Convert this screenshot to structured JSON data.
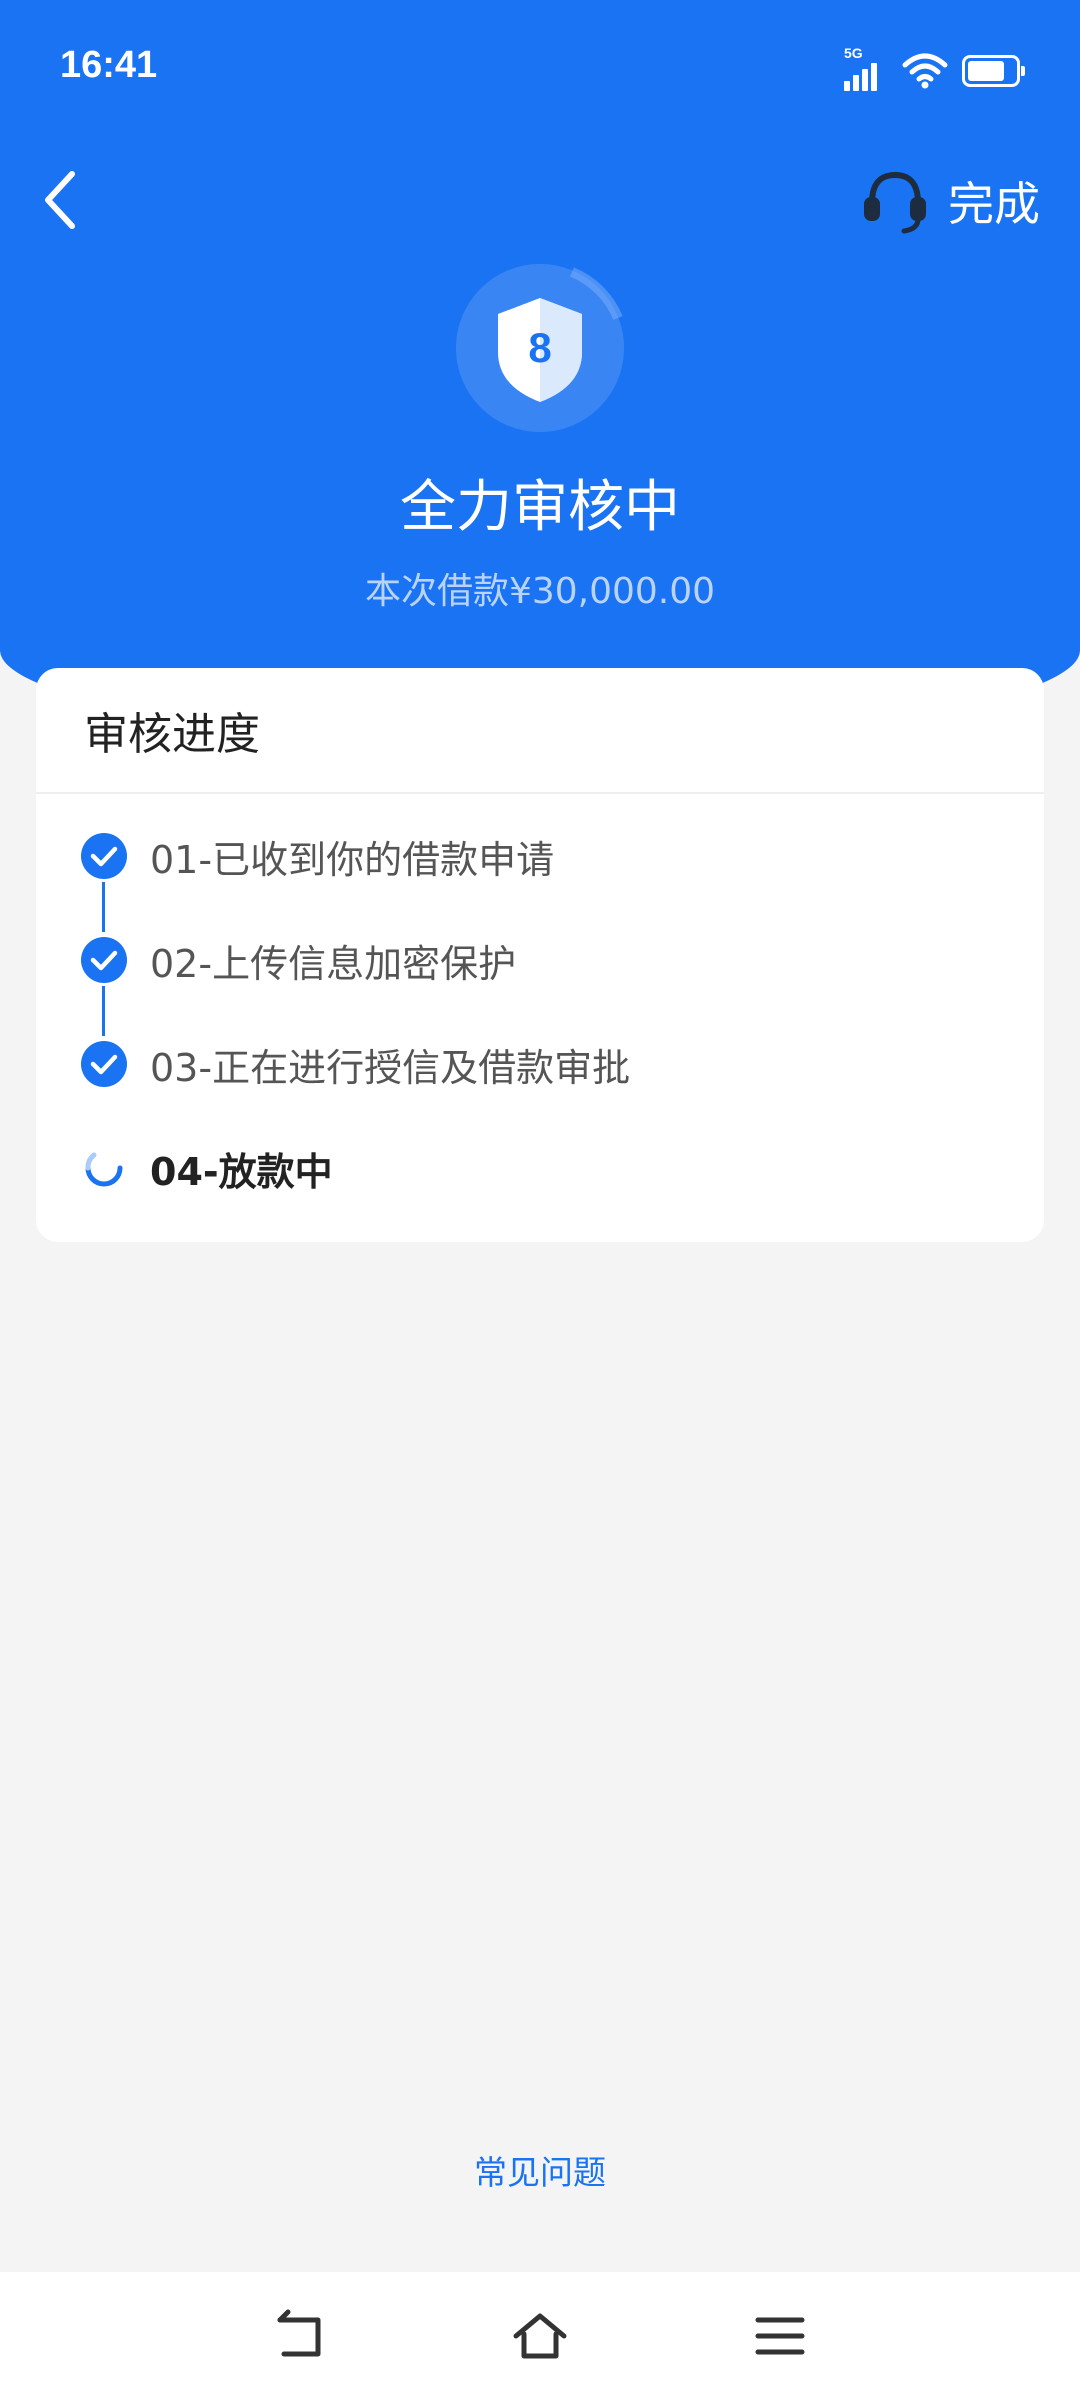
{
  "status_bar": {
    "time": "16:41",
    "network_label": "5G",
    "icons": [
      "signal-icon",
      "wifi-icon",
      "battery-icon"
    ]
  },
  "header": {
    "back_icon": "chevron-left-icon",
    "service_icon": "headset-icon",
    "done_label": "完成"
  },
  "hero": {
    "badge_number": "8",
    "badge_icon": "shield-icon",
    "title": "全力审核中",
    "subtitle": "本次借款¥30,000.00"
  },
  "progress": {
    "title": "审核进度",
    "steps": [
      {
        "label": "01-已收到你的借款申请",
        "state": "done"
      },
      {
        "label": "02-上传信息加密保护",
        "state": "done"
      },
      {
        "label": "03-正在进行授信及借款审批",
        "state": "done"
      },
      {
        "label": "04-放款中",
        "state": "in_progress"
      }
    ]
  },
  "footer": {
    "faq_label": "常见问题"
  },
  "nav_bar": {
    "icons": [
      "back-nav-icon",
      "home-nav-icon",
      "menu-nav-icon"
    ]
  },
  "colors": {
    "primary": "#1a73f2",
    "background": "#f4f4f4",
    "card": "#ffffff"
  }
}
